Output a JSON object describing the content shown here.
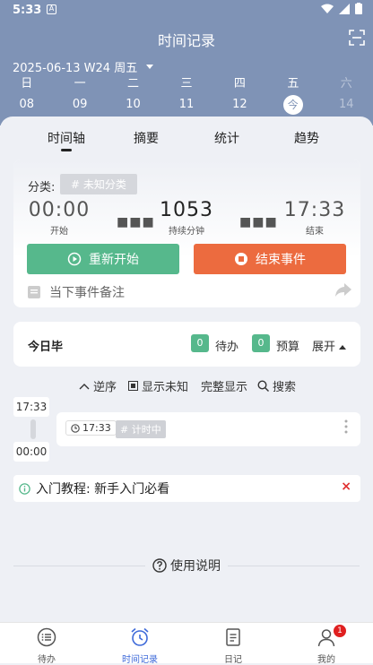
{
  "status_bar": {
    "time": "5:33",
    "notif_letter": "A"
  },
  "header": {
    "title": "时间记录",
    "date_label": "2025-06-13 W24 周五",
    "week": [
      {
        "weekday": "日",
        "date": "08"
      },
      {
        "weekday": "一",
        "date": "09"
      },
      {
        "weekday": "二",
        "date": "10"
      },
      {
        "weekday": "三",
        "date": "11"
      },
      {
        "weekday": "四",
        "date": "12"
      },
      {
        "weekday": "五",
        "date": "今"
      },
      {
        "weekday": "六",
        "date": "14"
      }
    ]
  },
  "tabs": [
    "时间轴",
    "摘要",
    "统计",
    "趋势"
  ],
  "current_event": {
    "category_label": "分类:",
    "category_value": "# 未知分类",
    "start_time": "00:00",
    "start_label": "开始",
    "duration_value": "1053",
    "duration_label": "持续分钟",
    "end_time": "17:33",
    "end_label": "结束",
    "restart_label": "重新开始",
    "end_event_label": "结束事件",
    "note_placeholder": "当下事件备注",
    "dots": "■■■"
  },
  "today": {
    "title": "今日毕",
    "todo_count": "0",
    "todo_label": "待办",
    "budget_count": "0",
    "budget_label": "预算",
    "expand_label": "展开"
  },
  "options": {
    "reverse": "逆序",
    "show_unknown": "显示未知",
    "full_display": "完整显示",
    "search": "搜索"
  },
  "timeline": {
    "time_top": "17:33",
    "time_bottom": "00:00",
    "event_time": "17:33",
    "event_tag": "# 计时中"
  },
  "tutorial": {
    "text": "入门教程: 新手入门必看",
    "close": "×"
  },
  "help_label": "使用说明",
  "bottom_nav": [
    {
      "label": "待办"
    },
    {
      "label": "时间记录"
    },
    {
      "label": "日记"
    },
    {
      "label": "我的",
      "badge": "1"
    }
  ],
  "colors": {
    "header": "#7f93b6",
    "green": "#56b88c",
    "orange": "#ec6b3f",
    "active": "#3e6ad9",
    "badge": "#e02020"
  }
}
